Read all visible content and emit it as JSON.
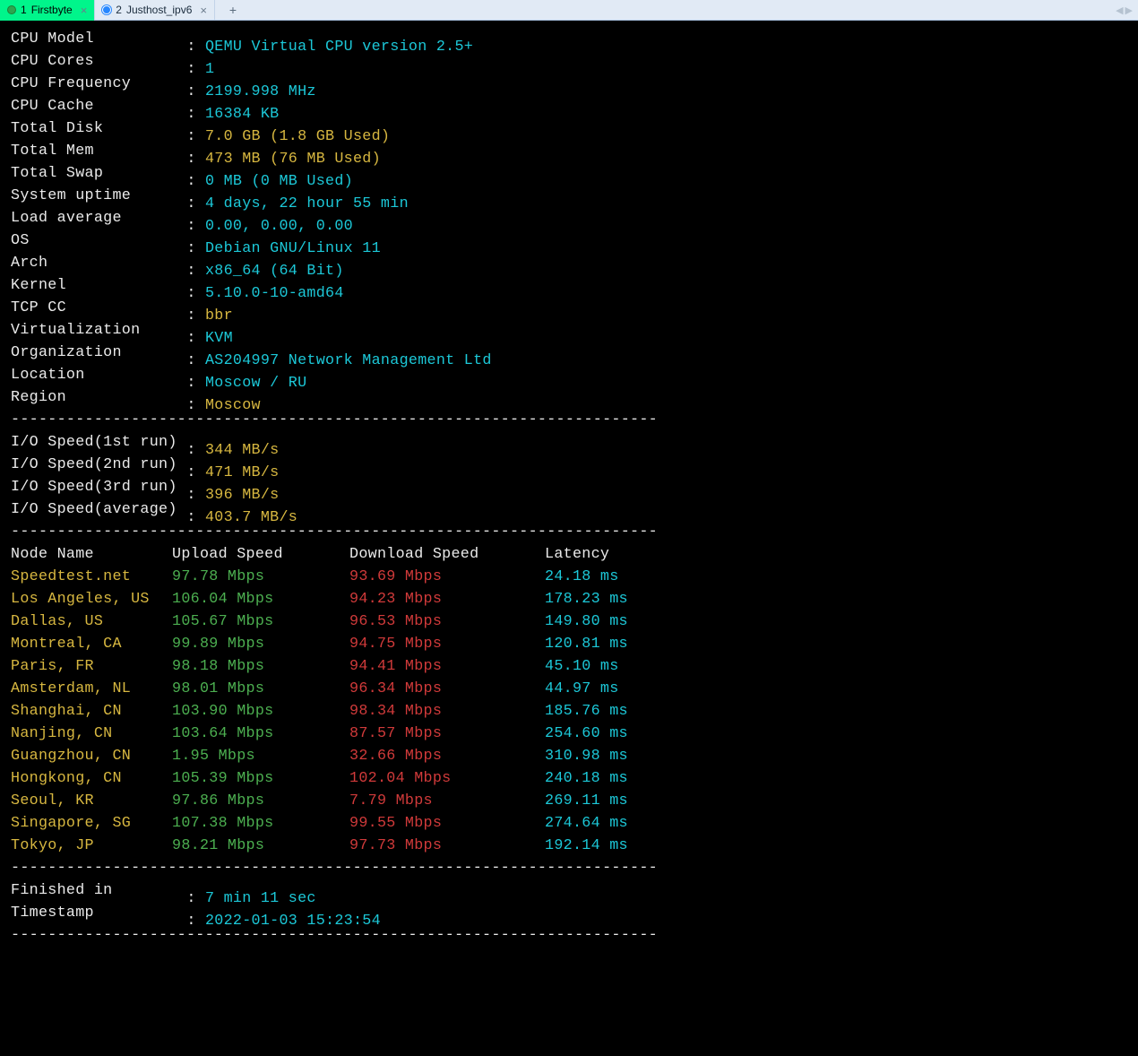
{
  "tabs": {
    "active_index": 0,
    "items": [
      {
        "num": "1",
        "label": "Firstbyte",
        "dot": "g"
      },
      {
        "num": "2",
        "label": "Justhost_ipv6",
        "dot": "o"
      }
    ],
    "close_glyph": "×",
    "plus_glyph": "+",
    "arrows": {
      "left": "◀",
      "right": "▶"
    }
  },
  "separator": "----------------------------------------------------------------------",
  "sysinfo": [
    {
      "label": "CPU Model",
      "value": "QEMU Virtual CPU version 2.5+",
      "color": "cy"
    },
    {
      "label": "CPU Cores",
      "value": "1",
      "color": "cy"
    },
    {
      "label": "CPU Frequency",
      "value": "2199.998 MHz",
      "color": "cy"
    },
    {
      "label": "CPU Cache",
      "value": "16384 KB",
      "color": "cy"
    },
    {
      "label": "Total Disk",
      "value": "7.0 GB (1.8 GB Used)",
      "color": "yl"
    },
    {
      "label": "Total Mem",
      "value": "473 MB (76 MB Used)",
      "color": "yl"
    },
    {
      "label": "Total Swap",
      "value": "0 MB (0 MB Used)",
      "color": "cy"
    },
    {
      "label": "System uptime",
      "value": "4 days, 22 hour 55 min",
      "color": "cy"
    },
    {
      "label": "Load average",
      "value": "0.00, 0.00, 0.00",
      "color": "cy"
    },
    {
      "label": "OS",
      "value": "Debian GNU/Linux 11",
      "color": "cy"
    },
    {
      "label": "Arch",
      "value": "x86_64 (64 Bit)",
      "color": "cy"
    },
    {
      "label": "Kernel",
      "value": "5.10.0-10-amd64",
      "color": "cy"
    },
    {
      "label": "TCP CC",
      "value": "bbr",
      "color": "yl"
    },
    {
      "label": "Virtualization",
      "value": "KVM",
      "color": "cy"
    },
    {
      "label": "Organization",
      "value": "AS204997 Network Management Ltd",
      "color": "cy"
    },
    {
      "label": "Location",
      "value": "Moscow / RU",
      "color": "cy"
    },
    {
      "label": "Region",
      "value": "Moscow",
      "color": "yl"
    }
  ],
  "iospeed": [
    {
      "label": "I/O Speed(1st run)",
      "value": "344 MB/s"
    },
    {
      "label": "I/O Speed(2nd run)",
      "value": "471 MB/s"
    },
    {
      "label": "I/O Speed(3rd run)",
      "value": "396 MB/s"
    },
    {
      "label": "I/O Speed(average)",
      "value": "403.7 MB/s"
    }
  ],
  "speedtest": {
    "headers": {
      "node": "Node Name",
      "upload": "Upload Speed",
      "download": "Download Speed",
      "latency": "Latency"
    },
    "rows": [
      {
        "node": "Speedtest.net",
        "upload": "97.78 Mbps",
        "download": "93.69 Mbps",
        "latency": "24.18 ms"
      },
      {
        "node": "Los Angeles, US",
        "upload": "106.04 Mbps",
        "download": "94.23 Mbps",
        "latency": "178.23 ms"
      },
      {
        "node": "Dallas, US",
        "upload": "105.67 Mbps",
        "download": "96.53 Mbps",
        "latency": "149.80 ms"
      },
      {
        "node": "Montreal, CA",
        "upload": "99.89 Mbps",
        "download": "94.75 Mbps",
        "latency": "120.81 ms"
      },
      {
        "node": "Paris, FR",
        "upload": "98.18 Mbps",
        "download": "94.41 Mbps",
        "latency": "45.10 ms"
      },
      {
        "node": "Amsterdam, NL",
        "upload": "98.01 Mbps",
        "download": "96.34 Mbps",
        "latency": "44.97 ms"
      },
      {
        "node": "Shanghai, CN",
        "upload": "103.90 Mbps",
        "download": "98.34 Mbps",
        "latency": "185.76 ms"
      },
      {
        "node": "Nanjing, CN",
        "upload": "103.64 Mbps",
        "download": "87.57 Mbps",
        "latency": "254.60 ms"
      },
      {
        "node": "Guangzhou, CN",
        "upload": "1.95 Mbps",
        "download": "32.66 Mbps",
        "latency": "310.98 ms"
      },
      {
        "node": "Hongkong, CN",
        "upload": "105.39 Mbps",
        "download": "102.04 Mbps",
        "latency": "240.18 ms"
      },
      {
        "node": "Seoul, KR",
        "upload": "97.86 Mbps",
        "download": "7.79 Mbps",
        "latency": "269.11 ms"
      },
      {
        "node": "Singapore, SG",
        "upload": "107.38 Mbps",
        "download": "99.55 Mbps",
        "latency": "274.64 ms"
      },
      {
        "node": "Tokyo, JP",
        "upload": "98.21 Mbps",
        "download": "97.73 Mbps",
        "latency": "192.14 ms"
      }
    ]
  },
  "footer": [
    {
      "label": "Finished in",
      "value": "7 min 11 sec"
    },
    {
      "label": "Timestamp",
      "value": "2022-01-03 15:23:54"
    }
  ]
}
